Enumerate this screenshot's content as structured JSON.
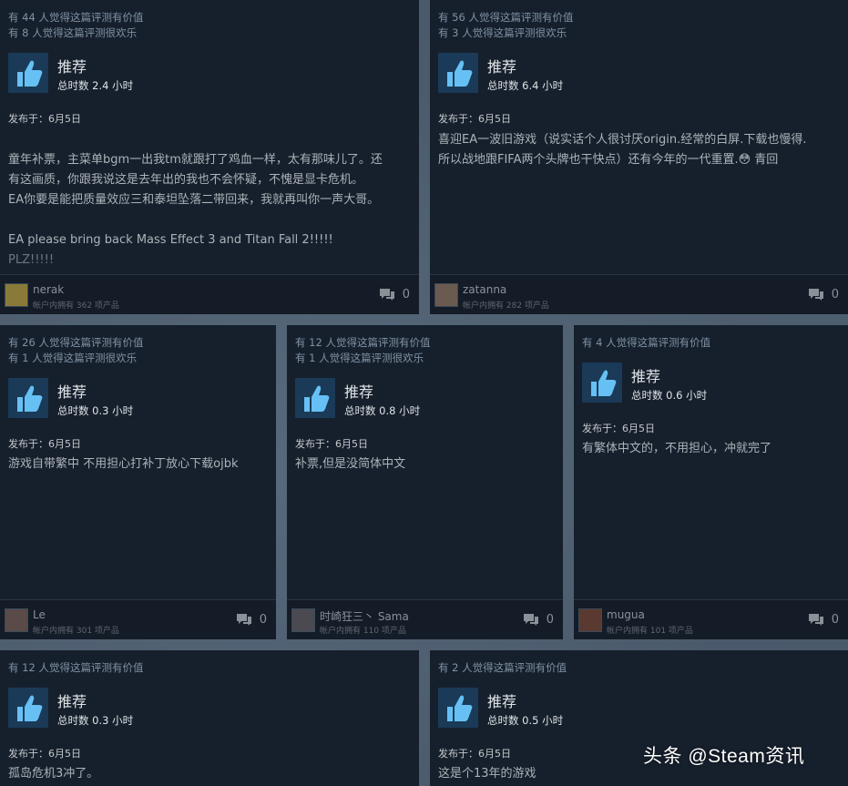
{
  "reviews": [
    {
      "helpful": "有 44 人觉得这篇评测有价值",
      "funny": "有 8 人觉得这篇评测很欢乐",
      "recommend": "推荐",
      "hours": "总时数 2.4 小时",
      "posted": "发布于：6月5日",
      "text_main": "童年补票，主菜单bgm一出我tm就跟打了鸡血一样，太有那味儿了。还\n有这画质，你跟我说这是去年出的我也不会怀疑，不愧是显卡危机。\nEA你要是能把质量效应三和泰坦坠落二带回来，我就再叫你一声大哥。\n\nEA please bring back Mass Effect 3 and Titan Fall 2!!!!!",
      "text_muted": "PLZ!!!!!",
      "user": "nerak",
      "owns": "帐户内拥有 362 项产品",
      "comments": "0"
    },
    {
      "helpful": "有 56 人觉得这篇评测有价值",
      "funny": "有 3 人觉得这篇评测很欢乐",
      "recommend": "推荐",
      "hours": "总时数 6.4 小时",
      "posted": "发布于：6月5日",
      "text_main": "喜迎EA一波旧游戏（说实话个人很讨厌origin.经常的白屏.下载也慢得.\n所以战地跟FIFA两个头牌也干快点）还有今年的一代重置.😳 青回",
      "user": "zatanna",
      "owns": "帐户内拥有 282 项产品",
      "comments": "0"
    },
    {
      "helpful": "有 26 人觉得这篇评测有价值",
      "funny": "有 1 人觉得这篇评测很欢乐",
      "recommend": "推荐",
      "hours": "总时数 0.3 小时",
      "posted": "发布于：6月5日",
      "text_main": "游戏自带繁中 不用担心打补丁放心下载ojbk",
      "user": "Le",
      "owns": "帐户内拥有 301 项产品",
      "comments": "0"
    },
    {
      "helpful": "有 12 人觉得这篇评测有价值",
      "funny": "有 1 人觉得这篇评测很欢乐",
      "recommend": "推荐",
      "hours": "总时数 0.8 小时",
      "posted": "发布于：6月5日",
      "text_main": "补票,但是没简体中文",
      "user": "时崎狂三丶 Sama",
      "owns": "帐户内拥有 110 项产品",
      "comments": "0"
    },
    {
      "helpful": "有 4 人觉得这篇评测有价值",
      "recommend": "推荐",
      "hours": "总时数 0.6 小时",
      "posted": "发布于：6月5日",
      "text_main": "有繁体中文的，不用担心，冲就完了",
      "user": "mugua",
      "owns": "帐户内拥有 101 项产品",
      "comments": "0"
    },
    {
      "helpful": "有 12 人觉得这篇评测有价值",
      "recommend": "推荐",
      "hours": "总时数 0.3 小时",
      "posted": "发布于：6月5日",
      "text_main": "孤岛危机3冲了。"
    },
    {
      "helpful": "有 2 人觉得这篇评测有价值",
      "recommend": "推荐",
      "hours": "总时数 0.5 小时",
      "posted": "发布于：6月5日",
      "text_main": "这是个13年的游戏"
    }
  ],
  "watermark": "头条 @Steam资讯",
  "colors": {
    "thumb_bg": "#1a3a57",
    "thumb_fg": "#66c0f4",
    "card_bg": "#16202d"
  },
  "icons": {
    "thumb": "thumbs-up-icon",
    "comment": "comment-bubble-icon"
  }
}
